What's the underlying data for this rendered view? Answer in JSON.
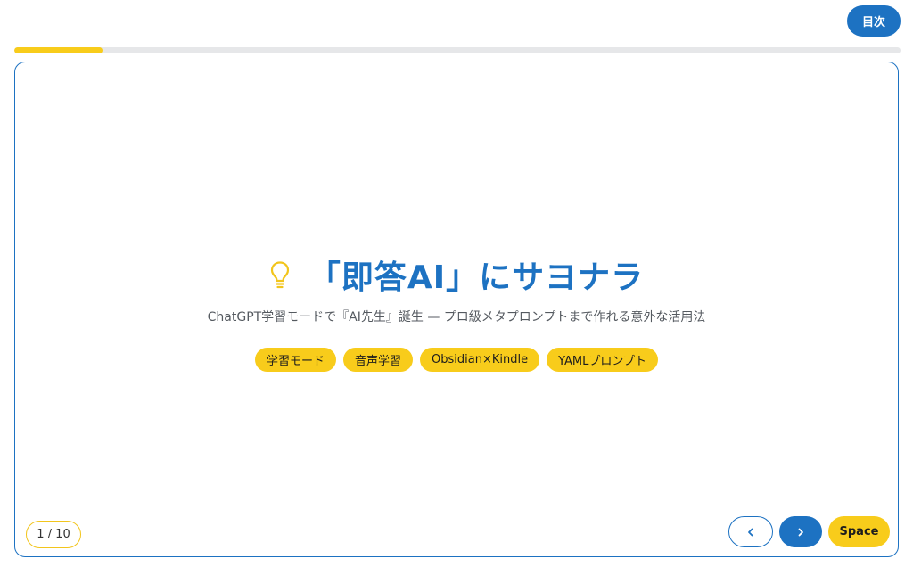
{
  "header": {
    "toc_label": "目次"
  },
  "progress": {
    "fraction": 0.1
  },
  "slide": {
    "icon": "lightbulb-icon",
    "title": "「即答AI」にサヨナラ",
    "subtitle": "ChatGPT学習モードで『AI先生』誕生 — プロ級メタプロンプトまで作れる意外な活用法",
    "tags": [
      "学習モード",
      "音声学習",
      "Obsidian×Kindle",
      "YAMLプロンプト"
    ]
  },
  "footer": {
    "page_indicator": "1 / 10",
    "prev_icon": "chevron-left-icon",
    "next_icon": "chevron-right-icon",
    "space_label": "Space"
  },
  "colors": {
    "primary": "#1d72c2",
    "accent": "#f8cc1b",
    "track": "#e6e7e9"
  }
}
